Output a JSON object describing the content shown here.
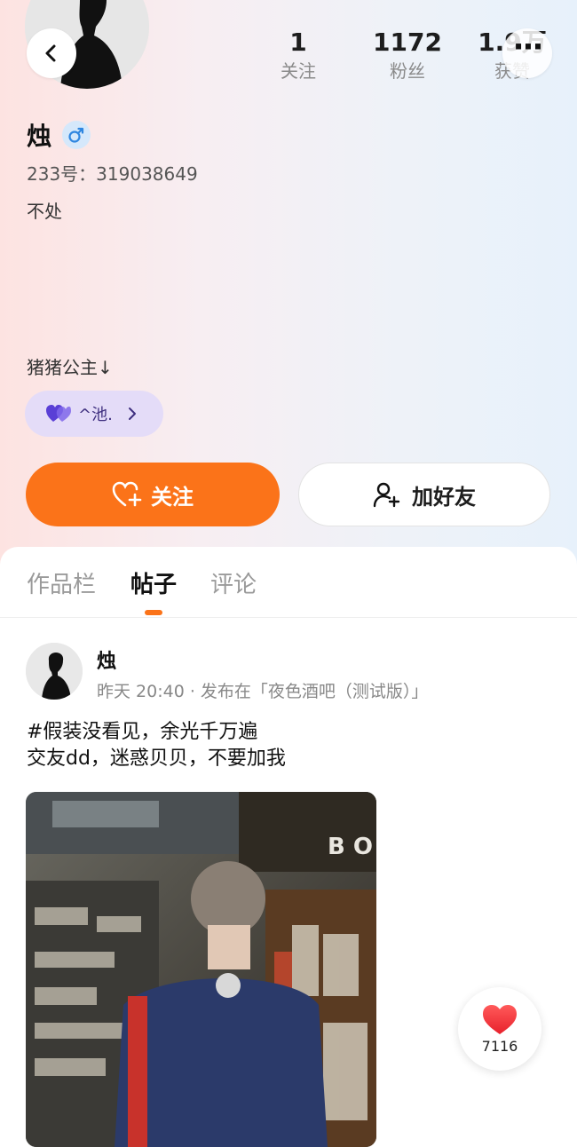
{
  "profile": {
    "name": "烛",
    "gender_icon": "male-icon",
    "id_line": "233号：319038649",
    "bio": "不处",
    "note": "猪猪公主↓",
    "tag_label": "^池.",
    "accent": "#fb7319"
  },
  "stats": {
    "follow_count": "1",
    "follow_label": "关注",
    "fans_count": "1172",
    "fans_label": "粉丝",
    "likes_count": "1.9万",
    "likes_label": "获赞"
  },
  "actions": {
    "follow_label": "关注",
    "add_friend_label": "加好友"
  },
  "tabs": [
    {
      "label": "作品栏"
    },
    {
      "label": "帖子"
    },
    {
      "label": "评论"
    }
  ],
  "post": {
    "author": "烛",
    "meta": "昨天 20:40 · 发布在「夜色酒吧（测试版）」",
    "line1": "#假装没看见，余光千万遍",
    "line2": "交友dd，迷惑贝贝，不要加我",
    "like_count": "7116"
  }
}
